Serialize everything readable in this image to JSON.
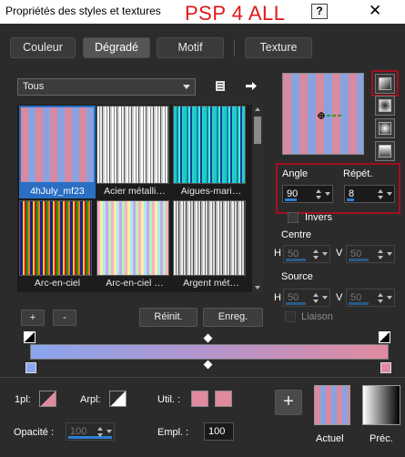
{
  "window": {
    "title": "Propriétés des styles et textures",
    "overlay_text": "PSP 4 ALL",
    "help_label": "?",
    "close_label": "✕"
  },
  "tabs": [
    {
      "label": "Couleur",
      "active": false
    },
    {
      "label": "Dégradé",
      "active": true
    },
    {
      "label": "Motif",
      "active": false
    },
    {
      "label": "Texture",
      "active": false
    }
  ],
  "category": {
    "selected": "Tous"
  },
  "toolbar": {
    "folder_icon": "folder-icon",
    "arrow_icon": "arrow-right-icon"
  },
  "gallery": {
    "items": [
      {
        "label": "4hJuly_mf23",
        "selected": true
      },
      {
        "label": "Acier métalli…",
        "selected": false
      },
      {
        "label": "Aigues-mari…",
        "selected": false
      },
      {
        "label": "Arc-en-ciel",
        "selected": false
      },
      {
        "label": "Arc-en-ciel …",
        "selected": false
      },
      {
        "label": "Argent mét…",
        "selected": false
      }
    ]
  },
  "gallery_buttons": {
    "add": "+",
    "remove": "-",
    "reset": "Réinit.",
    "save": "Enreg."
  },
  "angle": {
    "label": "Angle",
    "value": "90"
  },
  "repeat": {
    "label": "Répét.",
    "value": "8"
  },
  "invert": {
    "label": "Invers"
  },
  "centre": {
    "label": "Centre",
    "h_label": "H",
    "h_value": "50",
    "v_label": "V",
    "v_value": "50"
  },
  "source": {
    "label": "Source",
    "h_label": "H",
    "h_value": "50",
    "v_label": "V",
    "v_value": "50"
  },
  "link": {
    "label": "Liaison"
  },
  "bottom": {
    "fill_label": "1pl:",
    "arpl_label": "Arpl:",
    "util_label": "Util. :",
    "opacity_label": "Opacité :",
    "opacity_value": "100",
    "empl_label": "Empl. :",
    "empl_value": "100",
    "add_label": "+",
    "current_label": "Actuel",
    "previous_label": "Préc."
  },
  "colors": {
    "pink": "#e08aa0",
    "blue": "#8aa6ee",
    "accent": "#2d7fd4",
    "highlight": "#a41020"
  }
}
